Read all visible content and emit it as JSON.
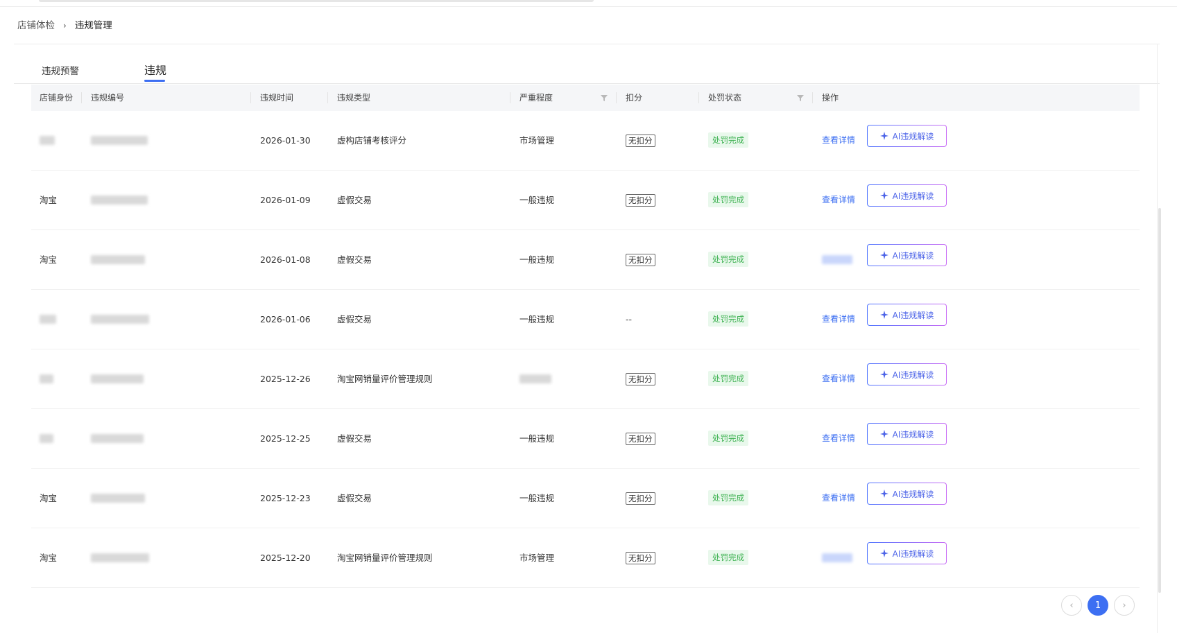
{
  "breadcrumb": {
    "parent": "店铺体检",
    "separator": "›",
    "current": "违规管理"
  },
  "tabs": [
    {
      "label": "违规预警",
      "active": false
    },
    {
      "label": "违规",
      "active": true
    }
  ],
  "table": {
    "columns": [
      "店铺身份",
      "违规编号",
      "违规时间",
      "违规类型",
      "严重程度",
      "扣分",
      "处罚状态",
      "操作"
    ],
    "rows": [
      {
        "shop": "",
        "id": "",
        "time": "2026-01-30",
        "type": "虚构店铺考核评分",
        "severity": "市场管理",
        "deduct": "无扣分",
        "status": "处罚完成",
        "detail": "查看详情",
        "ai": "AI违规解读"
      },
      {
        "shop": "淘宝",
        "id": "",
        "time": "2026-01-09",
        "type": "虚假交易",
        "severity": "一般违规",
        "deduct": "无扣分",
        "status": "处罚完成",
        "detail": "查看详情",
        "ai": "AI违规解读"
      },
      {
        "shop": "淘宝",
        "id": "",
        "time": "2026-01-08",
        "type": "虚假交易",
        "severity": "一般违规",
        "deduct": "无扣分",
        "status": "处罚完成",
        "detail": "",
        "ai": "AI违规解读"
      },
      {
        "shop": "",
        "id": "",
        "time": "2026-01-06",
        "type": "虚假交易",
        "severity": "一般违规",
        "deduct": "--",
        "status": "处罚完成",
        "detail": "查看详情",
        "ai": "AI违规解读"
      },
      {
        "shop": "",
        "id": "",
        "time": "2025-12-26",
        "type": "淘宝网销量评价管理规则",
        "severity": "",
        "deduct": "无扣分",
        "status": "处罚完成",
        "detail": "查看详情",
        "ai": "AI违规解读"
      },
      {
        "shop": "",
        "id": "",
        "time": "2025-12-25",
        "type": "虚假交易",
        "severity": "一般违规",
        "deduct": "无扣分",
        "status": "处罚完成",
        "detail": "查看详情",
        "ai": "AI违规解读"
      },
      {
        "shop": "淘宝",
        "id": "",
        "time": "2025-12-23",
        "type": "虚假交易",
        "severity": "一般违规",
        "deduct": "无扣分",
        "status": "处罚完成",
        "detail": "查看详情",
        "ai": "AI违规解读"
      },
      {
        "shop": "淘宝",
        "id": "",
        "time": "2025-12-20",
        "type": "淘宝网销量评价管理规则",
        "severity": "市场管理",
        "deduct": "无扣分",
        "status": "处罚完成",
        "detail": "",
        "ai": "AI违规解读"
      }
    ]
  },
  "pagination": {
    "prev": "‹",
    "current": "1",
    "next": "›"
  },
  "colors": {
    "accent": "#3d6ff2",
    "status_green": "#3cb150",
    "status_green_bg": "#e9f8ec",
    "ai_gradient_start": "#4e74ff",
    "ai_gradient_end": "#c86bf5"
  },
  "icons": {
    "filter": "filter-icon",
    "sparkle": "sparkle-icon",
    "prev": "chevron-left-icon",
    "next": "chevron-right-icon"
  }
}
